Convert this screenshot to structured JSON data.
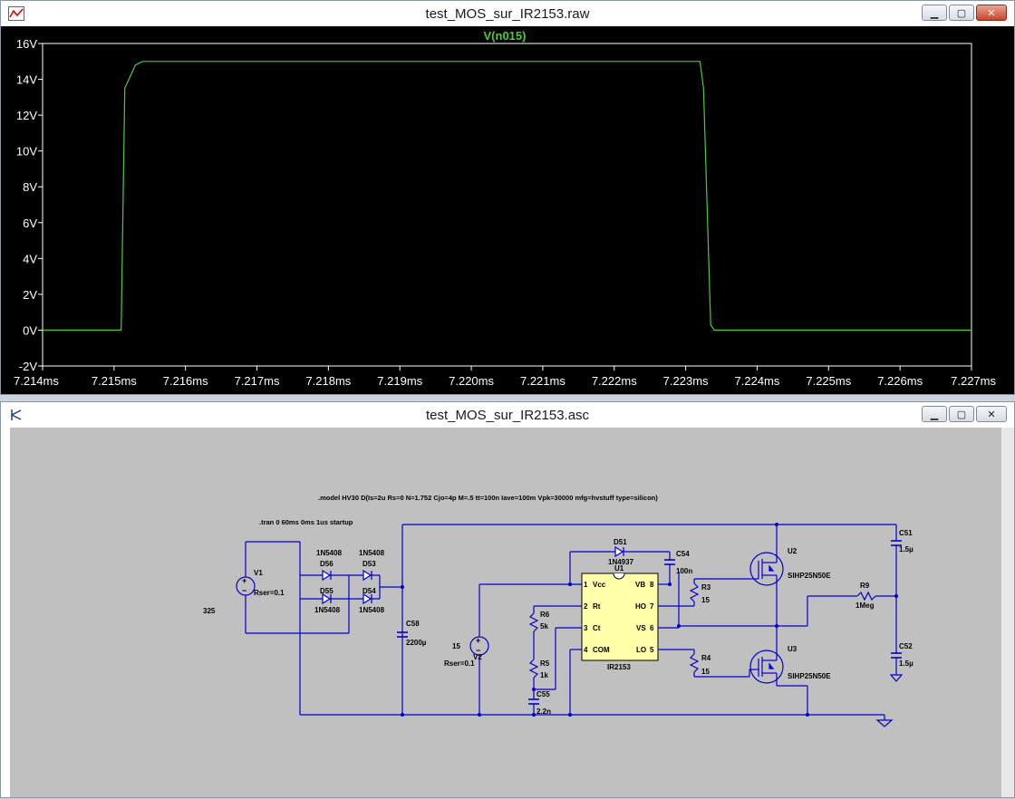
{
  "waveform_window": {
    "title": "test_MOS_sur_IR2153.raw",
    "trace_label": "V(n015)",
    "colors": {
      "background": "#000000",
      "trace": "#4ccc3a",
      "axis": "#ffffff"
    },
    "chart_data": {
      "type": "line",
      "series": [
        {
          "name": "V(n015)",
          "x": [
            7.214,
            7.2151,
            7.21515,
            7.2153,
            7.2154,
            7.2232,
            7.22325,
            7.22335,
            7.2234,
            7.227
          ],
          "y": [
            0,
            0,
            13.5,
            14.8,
            15,
            15,
            13.5,
            0.3,
            0,
            0
          ]
        }
      ],
      "xlim": [
        7.214,
        7.227
      ],
      "ylim": [
        -2,
        16
      ],
      "x_ticks": [
        "7.214ms",
        "7.215ms",
        "7.216ms",
        "7.217ms",
        "7.218ms",
        "7.219ms",
        "7.220ms",
        "7.221ms",
        "7.222ms",
        "7.223ms",
        "7.224ms",
        "7.225ms",
        "7.226ms",
        "7.227ms"
      ],
      "y_ticks": [
        "16V",
        "14V",
        "12V",
        "10V",
        "8V",
        "6V",
        "4V",
        "2V",
        "0V",
        "-2V"
      ],
      "y_tick_values": [
        16,
        14,
        12,
        10,
        8,
        6,
        4,
        2,
        0,
        -2
      ]
    }
  },
  "schematic_window": {
    "title": "test_MOS_sur_IR2153.asc",
    "directives": {
      "model": ".model HV30 D(Is=2u Rs=0 N=1.752 Cjo=4p M=.5 tt=100n Iave=100m Vpk=30000 mfg=hvstuff type=silicon)",
      "tran": ".tran 0 60ms 0ms 1us startup"
    },
    "labels": {
      "v1": "V1",
      "v1_ser": "Rser=0.1",
      "v1_val": "325",
      "d56": "D56",
      "d53": "D53",
      "d55": "D55",
      "d54": "D54",
      "d_model_1": "1N5408",
      "d_model_2": "1N5408",
      "d_model_3": "1N5408",
      "d_model_4": "1N5408",
      "c58": "C58",
      "c58_val": "2200µ",
      "v2": "V2",
      "v2_val": "15",
      "v2_ser": "Rser=0.1",
      "r6": "R6",
      "r6_val": "5k",
      "r5": "R5",
      "r5_val": "1k",
      "c55": "C55",
      "c55_val": "2.2n",
      "d51": "D51",
      "d51_model": "1N4937",
      "c54": "C54",
      "c54_val": "100n",
      "u1": "U1",
      "u1_name": "IR2153",
      "pin1": "1",
      "pin1_name": "Vcc",
      "pin2": "2",
      "pin2_name": "Rt",
      "pin3": "3",
      "pin3_name": "Ct",
      "pin4": "4",
      "pin4_name": "COM",
      "pin8": "8",
      "pin8_name": "VB",
      "pin7": "7",
      "pin7_name": "HO",
      "pin6": "6",
      "pin6_name": "VS",
      "pin5": "5",
      "pin5_name": "LO",
      "r3": "R3",
      "r3_val": "15",
      "r4": "R4",
      "r4_val": "15",
      "u2": "U2",
      "u2_model": "SIHP25N50E",
      "u3": "U3",
      "u3_model": "SIHP25N50E",
      "c51": "C51",
      "c51_val": "1.5µ",
      "c52": "C52",
      "c52_val": "1.5µ",
      "r9": "R9",
      "r9_val": "1Meg"
    },
    "colors": {
      "background": "#c0c0c0",
      "wire": "#0000cc",
      "text": "#000000",
      "chip": "#ffffaa"
    }
  }
}
